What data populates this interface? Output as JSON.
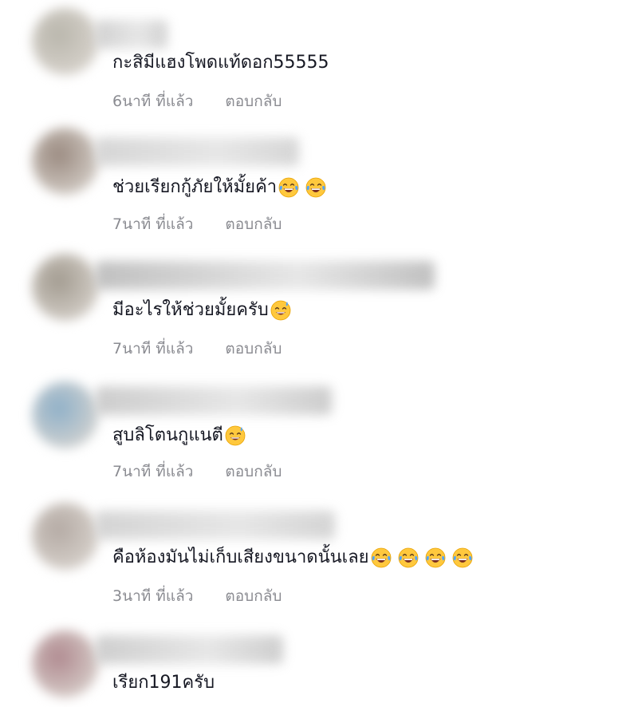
{
  "comments": [
    {
      "text": "กะสิมีแฮงโพดแท้ดอก55555",
      "time": "6นาที ที่แล้ว",
      "reply": "ตอบกลับ",
      "emojis": [],
      "avatar_color": "#b9b6ac",
      "name_color": "#c9c9c9"
    },
    {
      "text": "ช่วยเรียกกู้ภัยให้มั้ยค้า",
      "time": "7นาที ที่แล้ว",
      "reply": "ตอบกลับ",
      "emojis": [
        "laugh-cry",
        "laugh-cry"
      ],
      "avatar_color": "#9a8a80",
      "name_color": "#cfcfcf"
    },
    {
      "text": "มีอะไรให้ช่วยมั้ยครับ",
      "time": "7นาที ที่แล้ว",
      "reply": "ตอบกลับ",
      "emojis": [
        "sweat-smile"
      ],
      "avatar_color": "#a29b90",
      "name_color": "#b6b6b6"
    },
    {
      "text": "สูบลิโตนกูแนตี",
      "time": "7นาที ที่แล้ว",
      "reply": "ตอบกลับ",
      "emojis": [
        "sweat-smile"
      ],
      "avatar_color": "#8fb0c8",
      "name_color": "#c4c4c4"
    },
    {
      "text": "คือห้องมันไม่เก็บเสียงขนาดนั้นเลย",
      "time": "3นาที ที่แล้ว",
      "reply": "ตอบกลับ",
      "emojis": [
        "laugh-cry",
        "laugh-cry",
        "laugh-cry",
        "laugh-cry"
      ],
      "avatar_color": "#b4aaa4",
      "name_color": "#cdcdcd"
    },
    {
      "text": "เรียก191ครับ",
      "time": "",
      "reply": "",
      "emojis": [],
      "avatar_color": "#b08a90",
      "name_color": "#c6c6c6"
    }
  ]
}
